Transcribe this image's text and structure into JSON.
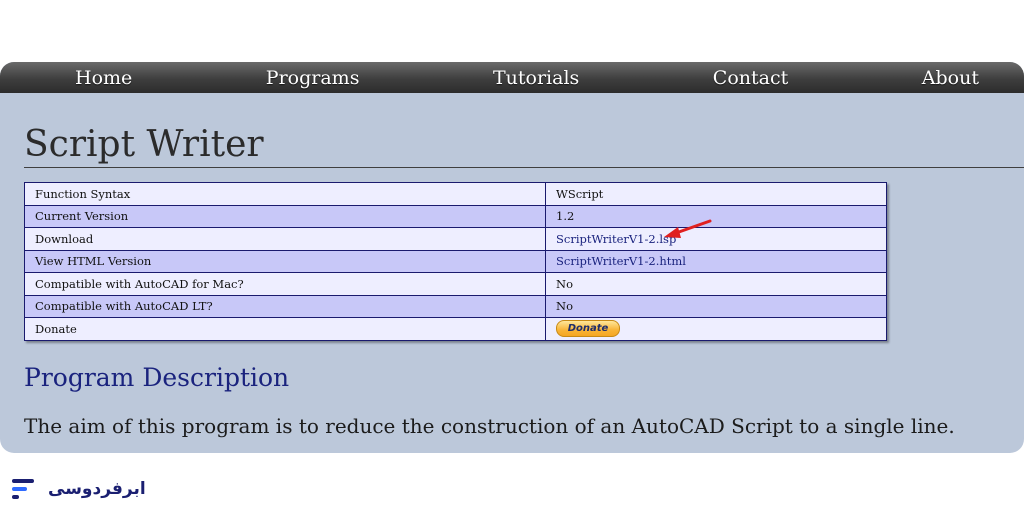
{
  "nav": {
    "items": [
      "Home",
      "Programs",
      "Tutorials",
      "Contact",
      "About"
    ]
  },
  "page": {
    "title": "Script Writer"
  },
  "info_table": {
    "rows": [
      {
        "key": "Function Syntax",
        "value": "WScript"
      },
      {
        "key": "Current Version",
        "value": "1.2"
      },
      {
        "key": "Download",
        "value": "ScriptWriterV1-2.lsp"
      },
      {
        "key": "View HTML Version",
        "value": "ScriptWriterV1-2.html"
      },
      {
        "key": "Compatible with AutoCAD for Mac?",
        "value": "No"
      },
      {
        "key": "Compatible with AutoCAD LT?",
        "value": "No"
      },
      {
        "key": "Donate",
        "value": "Donate"
      }
    ]
  },
  "description": {
    "heading": "Program Description",
    "text": "The aim of this program is to reduce the construction of an AutoCAD Script to a single line."
  },
  "brand": {
    "name": "ابرفردوسی"
  },
  "colors": {
    "page_bg": "#bcc8da",
    "link": "#1a237e",
    "arrow": "#e02020",
    "brand": "#1a1f71"
  }
}
